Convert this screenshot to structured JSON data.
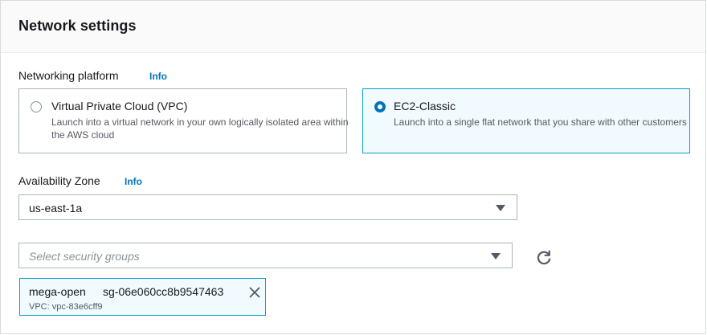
{
  "panel": {
    "title": "Network settings"
  },
  "networking": {
    "label": "Networking platform",
    "info": "Info",
    "options": [
      {
        "title": "Virtual Private Cloud (VPC)",
        "description": "Launch into a virtual network in your own logically isolated area within the AWS cloud",
        "selected": false
      },
      {
        "title": "EC2-Classic",
        "description": "Launch into a single flat network that you share with other customers",
        "selected": true
      }
    ]
  },
  "availability_zone": {
    "label": "Availability Zone",
    "info": "Info",
    "value": "us-east-1a"
  },
  "security_groups": {
    "placeholder": "Select security groups",
    "tokens": [
      {
        "name": "mega-open",
        "id": "sg-06e060cc8b9547463",
        "sub": "VPC: vpc-83e6cff9"
      }
    ]
  },
  "colors": {
    "accent": "#0073bb",
    "selected_border": "#00a1c9",
    "selected_bg": "#f1faff"
  }
}
